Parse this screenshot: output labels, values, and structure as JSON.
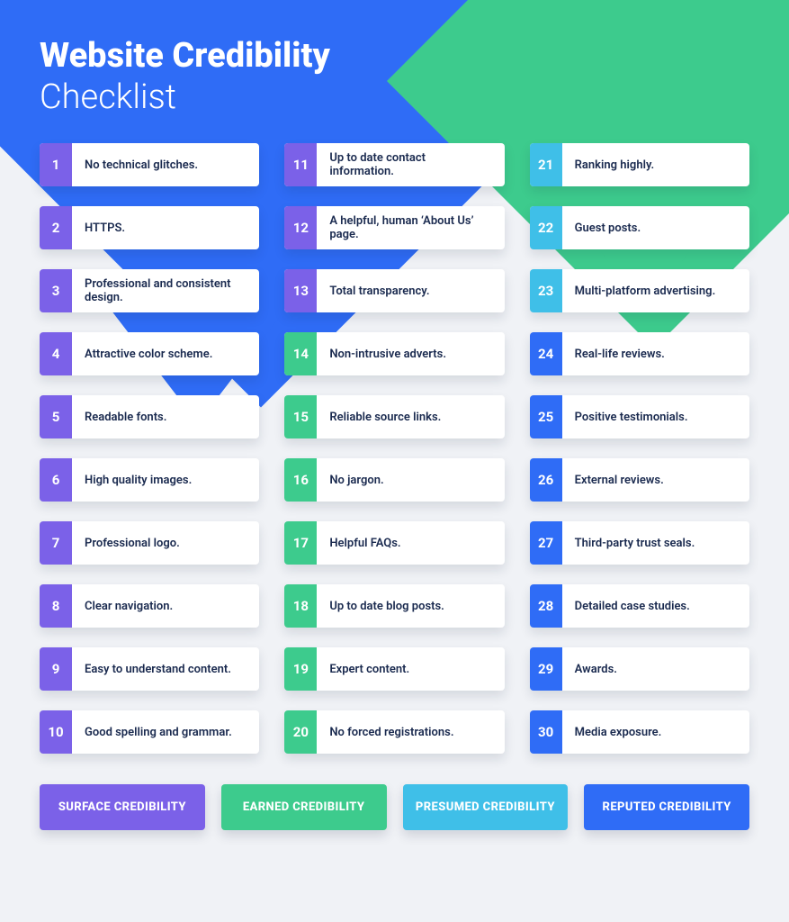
{
  "title_bold": "Website Credibility",
  "title_light": "Checklist",
  "colors": {
    "purple": "#7b61e8",
    "green": "#3dcb8d",
    "cyan": "#3fbfe8",
    "blue": "#2f6cf6"
  },
  "columns": [
    [
      {
        "n": "1",
        "text": "No technical glitches.",
        "color": "purple"
      },
      {
        "n": "2",
        "text": "HTTPS.",
        "color": "purple"
      },
      {
        "n": "3",
        "text": "Professional and consistent design.",
        "color": "purple"
      },
      {
        "n": "4",
        "text": "Attractive color scheme.",
        "color": "purple"
      },
      {
        "n": "5",
        "text": "Readable fonts.",
        "color": "purple"
      },
      {
        "n": "6",
        "text": "High quality images.",
        "color": "purple"
      },
      {
        "n": "7",
        "text": "Professional logo.",
        "color": "purple"
      },
      {
        "n": "8",
        "text": "Clear navigation.",
        "color": "purple"
      },
      {
        "n": "9",
        "text": "Easy to understand content.",
        "color": "purple"
      },
      {
        "n": "10",
        "text": "Good spelling and grammar.",
        "color": "purple"
      }
    ],
    [
      {
        "n": "11",
        "text": "Up to date contact information.",
        "color": "purple"
      },
      {
        "n": "12",
        "text": "A helpful, human ‘About Us’ page.",
        "color": "purple"
      },
      {
        "n": "13",
        "text": "Total transparency.",
        "color": "purple"
      },
      {
        "n": "14",
        "text": "Non-intrusive adverts.",
        "color": "green"
      },
      {
        "n": "15",
        "text": "Reliable source links.",
        "color": "green"
      },
      {
        "n": "16",
        "text": "No jargon.",
        "color": "green"
      },
      {
        "n": "17",
        "text": "Helpful FAQs.",
        "color": "green"
      },
      {
        "n": "18",
        "text": "Up to date blog posts.",
        "color": "green"
      },
      {
        "n": "19",
        "text": "Expert content.",
        "color": "green"
      },
      {
        "n": "20",
        "text": "No forced registrations.",
        "color": "green"
      }
    ],
    [
      {
        "n": "21",
        "text": "Ranking highly.",
        "color": "cyan"
      },
      {
        "n": "22",
        "text": "Guest posts.",
        "color": "cyan"
      },
      {
        "n": "23",
        "text": "Multi-platform advertising.",
        "color": "cyan"
      },
      {
        "n": "24",
        "text": "Real-life reviews.",
        "color": "blue"
      },
      {
        "n": "25",
        "text": "Positive testimonials.",
        "color": "blue"
      },
      {
        "n": "26",
        "text": "External reviews.",
        "color": "blue"
      },
      {
        "n": "27",
        "text": "Third-party trust seals.",
        "color": "blue"
      },
      {
        "n": "28",
        "text": "Detailed case studies.",
        "color": "blue"
      },
      {
        "n": "29",
        "text": "Awards.",
        "color": "blue"
      },
      {
        "n": "30",
        "text": "Media exposure.",
        "color": "blue"
      }
    ]
  ],
  "legend": [
    {
      "text": "SURFACE CREDIBILITY",
      "color": "purple"
    },
    {
      "text": "EARNED CREDIBILITY",
      "color": "green"
    },
    {
      "text": "PRESUMED CREDIBILITY",
      "color": "cyan"
    },
    {
      "text": "REPUTED CREDIBILITY",
      "color": "blue"
    }
  ]
}
